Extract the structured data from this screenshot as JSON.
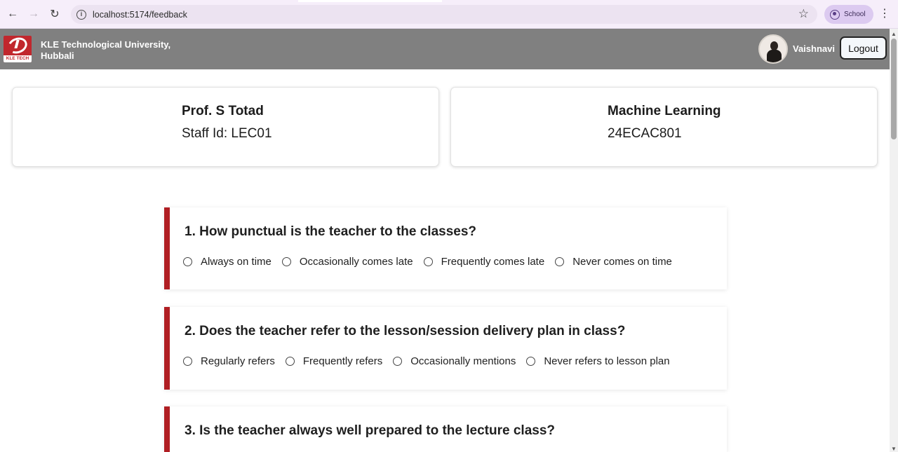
{
  "browser": {
    "url": "localhost:5174/feedback",
    "profile_label": "School"
  },
  "header": {
    "logo_text": "KLE TECH",
    "university_name": "KLE Technological University, Hubbali",
    "user_name": "Vaishnavi",
    "logout_label": "Logout"
  },
  "teacher_card": {
    "name": "Prof. S Totad",
    "staff_id": "Staff Id: LEC01"
  },
  "course_card": {
    "name": "Machine Learning",
    "code": "24ECAC801"
  },
  "colors": {
    "accent": "#b01e23",
    "header_bg": "#808080"
  },
  "questions": [
    {
      "text": "1. How punctual is the teacher to the classes?",
      "options": [
        "Always on time",
        "Occasionally comes late",
        "Frequently comes late",
        "Never comes on time"
      ]
    },
    {
      "text": "2. Does the teacher refer to the lesson/session delivery plan in class?",
      "options": [
        "Regularly refers",
        "Frequently refers",
        "Occasionally mentions",
        "Never refers to lesson plan"
      ]
    },
    {
      "text": "3. Is the teacher always well prepared to the lecture class?",
      "options": []
    }
  ]
}
